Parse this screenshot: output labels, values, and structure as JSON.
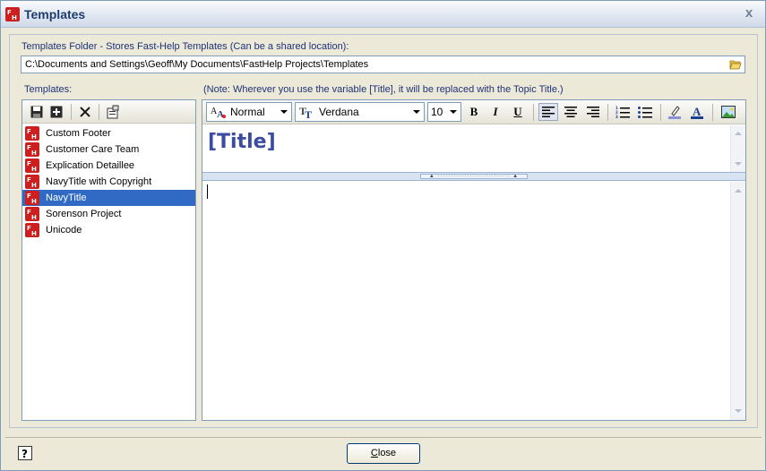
{
  "window": {
    "title": "Templates",
    "close_glyph": "x"
  },
  "folder": {
    "label": "Templates Folder - Stores Fast-Help Templates (Can be a shared location):",
    "value": "C:\\Documents and Settings\\Geoff\\My Documents\\FastHelp Projects\\Templates",
    "browse_icon": "folder-open-icon"
  },
  "templates": {
    "label": "Templates:",
    "toolbar": [
      "save-icon",
      "add-icon",
      "delete-icon",
      "properties-icon"
    ],
    "items": [
      {
        "label": "Custom Footer",
        "selected": false
      },
      {
        "label": "Customer Care Team",
        "selected": false
      },
      {
        "label": "Explication Detaillee",
        "selected": false
      },
      {
        "label": "NavyTitle with Copyright",
        "selected": false
      },
      {
        "label": "NavyTitle",
        "selected": true
      },
      {
        "label": "Sorenson Project",
        "selected": false
      },
      {
        "label": "Unicode",
        "selected": false
      }
    ]
  },
  "editor": {
    "note": "(Note: Wherever you use the variable [Title], it will be replaced with the Topic Title.)",
    "style_value": "Normal",
    "font_value": "Verdana",
    "size_value": "10",
    "bold": "B",
    "italic": "I",
    "underline": "U",
    "title_text": "[Title]",
    "body_text": ""
  },
  "footer": {
    "close_label": "Close",
    "close_mnemonic": "C",
    "close_rest": "lose"
  },
  "colors": {
    "selection": "#316ac5",
    "label_blue": "#1e3278",
    "title_navy": "#3a4ba0",
    "app_icon_red": "#cc1f1f"
  }
}
